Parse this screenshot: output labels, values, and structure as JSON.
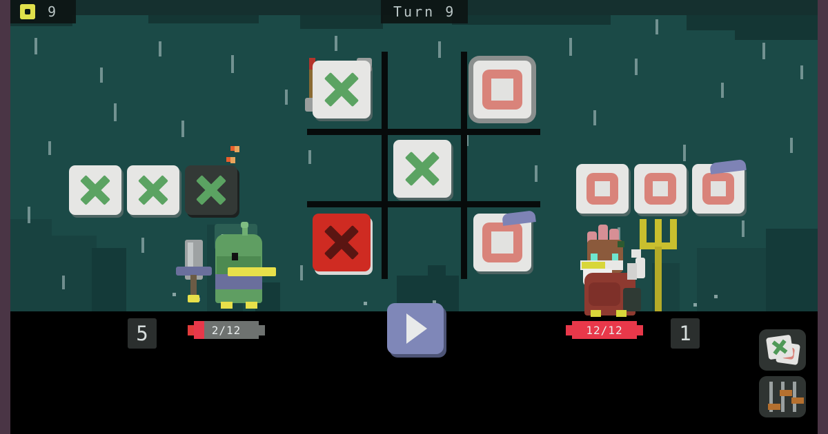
{
  "hud_top": {
    "coin_icon": "coin-icon",
    "coin_count": "9",
    "turn_label": "Turn  9"
  },
  "board": {
    "rows": 3,
    "cols": 3,
    "cells": [
      {
        "pos": "top-left",
        "mark": "X",
        "style": "plain",
        "decor": "crossed-axes"
      },
      {
        "pos": "top-center",
        "mark": "",
        "style": "empty",
        "decor": ""
      },
      {
        "pos": "top-right",
        "mark": "O",
        "style": "armored",
        "decor": ""
      },
      {
        "pos": "middle-left",
        "mark": "",
        "style": "empty",
        "decor": ""
      },
      {
        "pos": "middle-center",
        "mark": "X",
        "style": "plain",
        "decor": ""
      },
      {
        "pos": "middle-right",
        "mark": "",
        "style": "empty",
        "decor": ""
      },
      {
        "pos": "bottom-left",
        "mark": "X",
        "style": "red",
        "decor": ""
      },
      {
        "pos": "bottom-center",
        "mark": "",
        "style": "empty",
        "decor": ""
      },
      {
        "pos": "bottom-right",
        "mark": "O",
        "style": "plain",
        "decor": "shield"
      }
    ]
  },
  "player_left": {
    "name": "goblin",
    "hand": [
      {
        "mark": "X",
        "style": "plain",
        "decor": ""
      },
      {
        "mark": "X",
        "style": "plain",
        "decor": ""
      },
      {
        "mark": "X",
        "style": "dark",
        "decor": "bomb-fuse"
      }
    ],
    "count": "5",
    "hp_current": 2,
    "hp_max": 12,
    "hp_text": "2/12",
    "weapon": "sword"
  },
  "player_right": {
    "name": "rooster",
    "hand": [
      {
        "mark": "O",
        "style": "plain",
        "decor": ""
      },
      {
        "mark": "O",
        "style": "plain",
        "decor": ""
      },
      {
        "mark": "O",
        "style": "plain",
        "decor": "shield"
      }
    ],
    "count": "1",
    "hp_current": 12,
    "hp_max": 12,
    "hp_text": "12/12",
    "weapon": "pitchfork"
  },
  "controls": {
    "play_label": "play-turn",
    "cards_button": "cards-icon",
    "settings_button": "sliders-icon"
  },
  "colors": {
    "background": "#1b4a47",
    "letterbox": "#4a3545",
    "ground": "#000000",
    "x_mark": "#5ba362",
    "o_mark": "#d9837a",
    "hp_red": "#e8384a",
    "accent_blue": "#7f87b8",
    "coin_yellow": "#f2ef4e"
  }
}
